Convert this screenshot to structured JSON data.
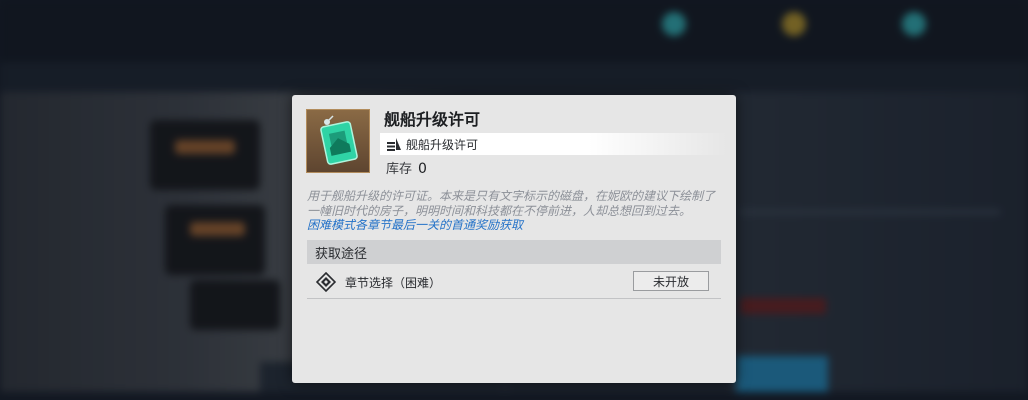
{
  "item": {
    "name": "舰船升级许可",
    "icon": "green-card-icon",
    "type_icon": "ship-upgrade-icon",
    "type_label": "舰船升级许可",
    "stock_label": "库存",
    "stock_value": "0",
    "description": "用于舰船升级的许可证。本来是只有文字标示的磁盘，在妮欧的建议下绘制了一幢旧时代的房子，明明时间和科技都在不停前进，人却总想回到过去。",
    "hint_link": "困难模式各章节最后一关的首通奖励获取"
  },
  "sources": {
    "header": "获取途径",
    "rows": [
      {
        "icon": "chapter-select-icon",
        "label": "章节选择（困难）",
        "button": "未开放"
      }
    ]
  },
  "colors": {
    "dialog_bg": "#e6e6e6",
    "link": "#2472c8",
    "item_frame": "#8a6a45",
    "card_green": "#2fd3a5"
  }
}
